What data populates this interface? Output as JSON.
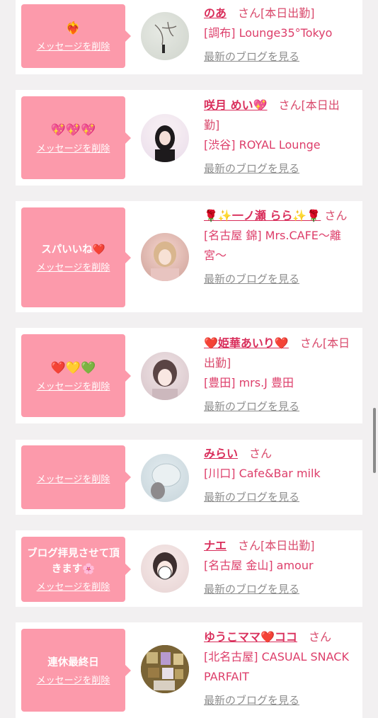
{
  "delete_label": "メッセージを削除",
  "blog_link": "最新のブログを見る",
  "colors": {
    "accent": "#fc9aab",
    "name": "#d92e5b",
    "text": "#dd3e6a",
    "link": "#8e8e8e"
  },
  "cards": [
    {
      "message": "❤️‍🔥",
      "name": "のあ",
      "san_text": "さん[本日出勤]",
      "shop": "[調布] Lounge35°Tokyo"
    },
    {
      "message": "💖💖💖",
      "name": "咲月 めい💖",
      "san_text": "さん[本日出勤]",
      "shop": "[渋谷] ROYAL Lounge"
    },
    {
      "message": "スパいいね❤️",
      "name": "🌹✨一ノ瀬 らら✨🌹",
      "san_text": "さん",
      "shop": "[名古屋 錦] Mrs.CAFE〜離宮〜"
    },
    {
      "message": "❤️💛💚",
      "name": "❤️姫華あいり❤️",
      "san_text": "さん[本日出勤]",
      "shop": "[豊田] mrs.J 豊田"
    },
    {
      "message": "",
      "name": "みらい",
      "san_text": "さん",
      "shop": "[川口] Cafe&Bar milk"
    },
    {
      "message": "ブログ拝見させて頂きます🌸",
      "name": "ナエ",
      "san_text": "さん[本日出勤]",
      "shop": "[名古屋 金山] amour"
    },
    {
      "message": "連休最終日",
      "name": "ゆうこママ❤️ココ",
      "san_text": "さん",
      "shop": "[北名古屋] CASUAL SNACK PARFAIT"
    }
  ]
}
